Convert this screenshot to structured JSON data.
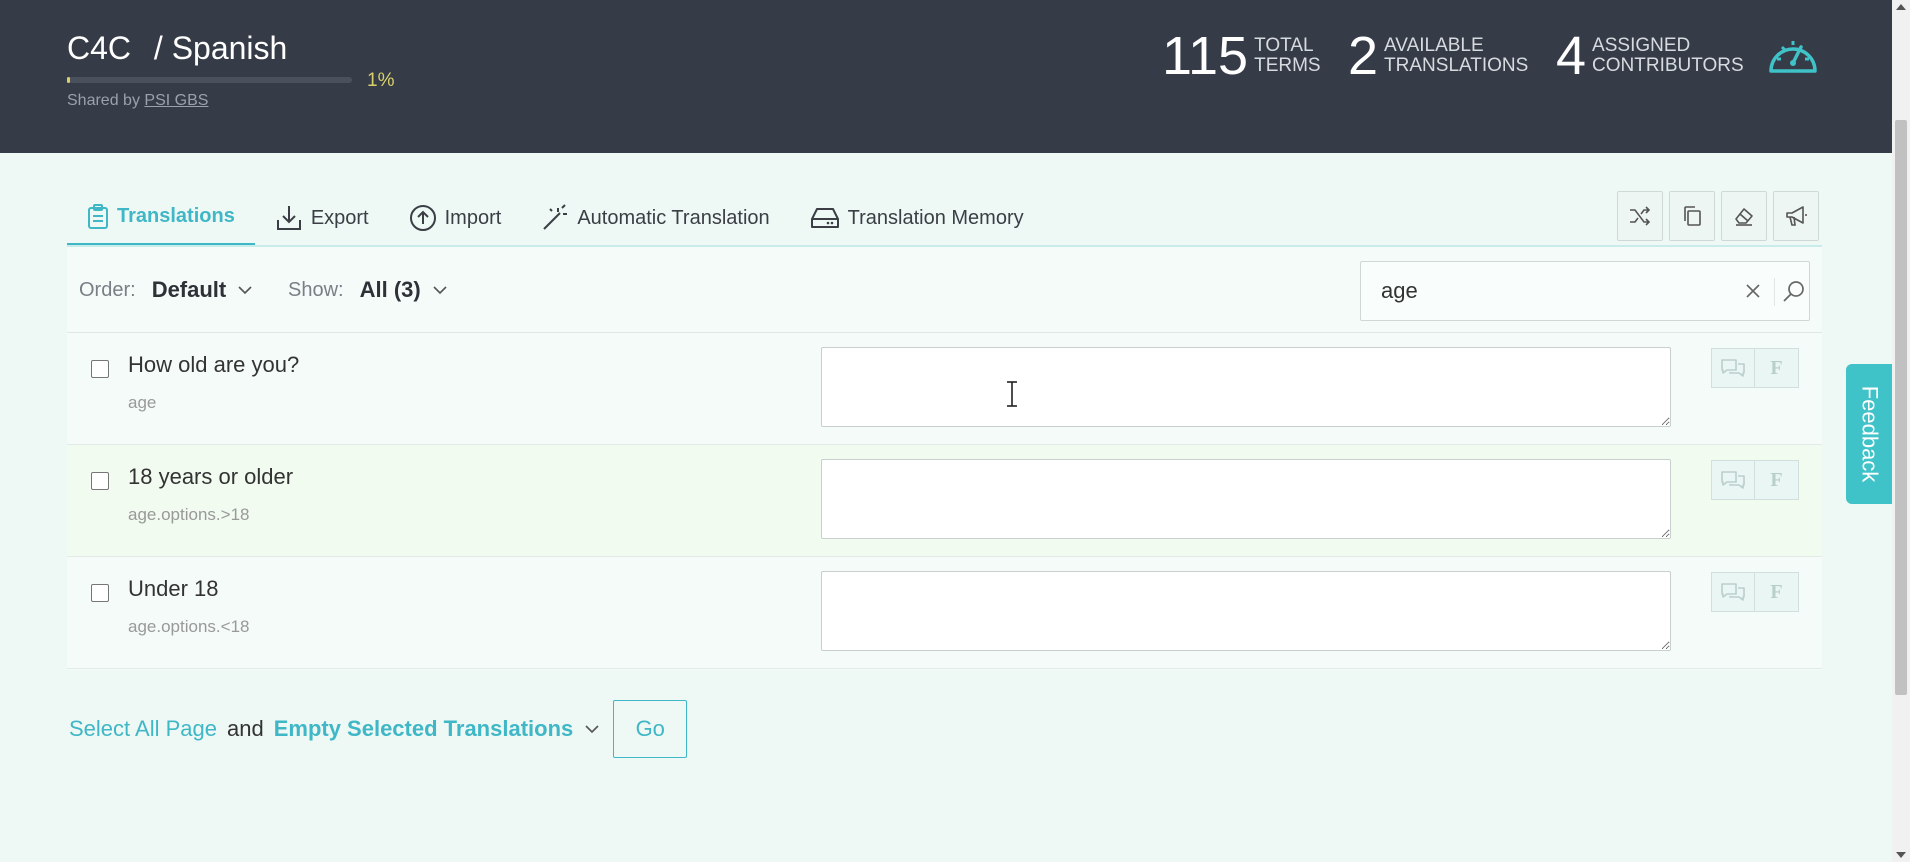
{
  "header": {
    "project": "C4C",
    "separator": "/",
    "language": "Spanish",
    "progress_pct": 1,
    "progress_label": "1%",
    "shared_prefix": "Shared by",
    "shared_by": "PSI GBS",
    "stats": [
      {
        "num": "115",
        "line1": "TOTAL",
        "line2": "TERMS"
      },
      {
        "num": "2",
        "line1": "AVAILABLE",
        "line2": "TRANSLATIONS"
      },
      {
        "num": "4",
        "line1": "ASSIGNED",
        "line2": "CONTRIBUTORS"
      }
    ],
    "dashboard_icon": "speedometer-icon"
  },
  "tabs": [
    {
      "label": "Translations",
      "icon": "clipboard-icon",
      "active": true
    },
    {
      "label": "Export",
      "icon": "download-tray-icon"
    },
    {
      "label": "Import",
      "icon": "upload-circle-icon"
    },
    {
      "label": "Automatic Translation",
      "icon": "magic-wand-icon"
    },
    {
      "label": "Translation Memory",
      "icon": "hard-drive-icon"
    }
  ],
  "tool_buttons": [
    "shuffle-icon",
    "copy-icon",
    "eraser-icon",
    "megaphone-icon"
  ],
  "filters": {
    "order_label": "Order:",
    "order_value": "Default",
    "show_label": "Show:",
    "show_value": "All (3)"
  },
  "search": {
    "value": "age"
  },
  "rows": [
    {
      "source": "How old are you?",
      "key_prefix": "age",
      "key_suffix": "",
      "translation": ""
    },
    {
      "source": "18 years or older",
      "key_prefix": "age",
      "key_suffix": ".options.>18",
      "translation": ""
    },
    {
      "source": "Under 18",
      "key_prefix": "age",
      "key_suffix": ".options.<18",
      "translation": ""
    }
  ],
  "row_buttons": {
    "comment_icon": "comments-icon",
    "f_label": "F"
  },
  "bulk": {
    "select_label": "Select All Page",
    "and_label": "and",
    "action_label": "Empty Selected Translations",
    "go_label": "Go"
  },
  "feedback_label": "Feedback",
  "colors": {
    "accent": "#3fb7c6",
    "header_bg": "#363c47",
    "progress": "#d8d06a"
  }
}
